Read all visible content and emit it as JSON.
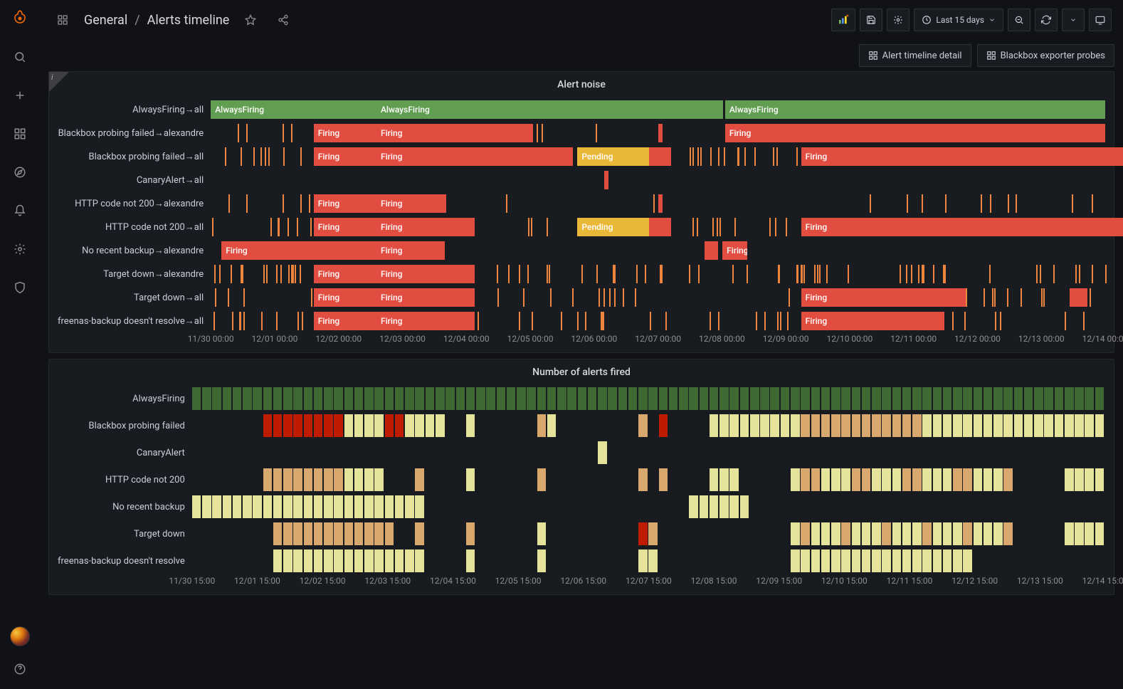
{
  "breadcrumbs": {
    "dashboards_icon": "apps-icon",
    "folder": "General",
    "sep": "/",
    "title": "Alerts timeline"
  },
  "toolbar": {
    "time_label": "Last 15 days",
    "links": [
      {
        "icon": "apps-icon",
        "label": "Alert timeline detail"
      },
      {
        "icon": "apps-icon",
        "label": "Blackbox exporter probes"
      }
    ]
  },
  "panel1": {
    "title": "Alert noise",
    "rows": [
      "AlwaysFiring→all",
      "Blackbox probing failed→alexandre",
      "Blackbox probing failed→all",
      "CanaryAlert→all",
      "HTTP code not 200→alexandre",
      "HTTP code not 200→all",
      "No recent backup→alexandre",
      "Target down→alexandre",
      "Target down→all",
      "freenas-backup doesn't resolve→all"
    ],
    "axis": [
      "11/30 00:00",
      "12/01 00:00",
      "12/02 00:00",
      "12/03 00:00",
      "12/04 00:00",
      "12/05 00:00",
      "12/06 00:00",
      "12/07 00:00",
      "12/08 00:00",
      "12/09 00:00",
      "12/10 00:00",
      "12/11 00:00",
      "12/12 00:00",
      "12/13 00:00",
      "12/14 00:00"
    ],
    "labels": {
      "firing": "Firing",
      "pending": "Pending",
      "always": "AlwaysFiring"
    },
    "chart_data": {
      "type": "timeline",
      "x_range_days": 15,
      "series_states": [
        "Firing",
        "Pending",
        "AlwaysFiring"
      ],
      "segments": {
        "AlwaysFiring→all": [
          {
            "state": "AlwaysFiring",
            "color": "green",
            "start": 0.0,
            "end": 57.3,
            "label": "AlwaysFiring"
          },
          {
            "state": "AlwaysFiring",
            "color": "green",
            "start": 57.5,
            "end": 100.0,
            "label": "AlwaysFiring"
          }
        ],
        "Blackbox probing failed→alexandre": [
          {
            "state": "Firing",
            "color": "red",
            "start": 11.5,
            "end": 36.0,
            "label": "Firing"
          },
          {
            "state": "Firing",
            "color": "red",
            "start": 50.0,
            "end": 50.3
          },
          {
            "state": "Firing",
            "color": "red",
            "start": 57.5,
            "end": 100.0,
            "label": "Firing"
          }
        ],
        "Blackbox probing failed→all": [
          {
            "state": "Pending",
            "color": "orange",
            "start": 0.0,
            "end": 100.0
          },
          {
            "state": "Firing",
            "color": "red",
            "start": 11.5,
            "end": 41.0,
            "label": "Firing"
          },
          {
            "state": "Pending",
            "color": "orange",
            "start": 41.0,
            "end": 49.0,
            "label": "Pending"
          },
          {
            "state": "Firing",
            "color": "red",
            "start": 66.0,
            "end": 100.0,
            "label": "Firing"
          }
        ]
      }
    }
  },
  "panel2": {
    "title": "Number of alerts fired",
    "rows": [
      "AlwaysFiring",
      "Blackbox probing failed",
      "CanaryAlert",
      "HTTP code not 200",
      "No recent backup",
      "Target down",
      "freenas-backup doesn't resolve"
    ],
    "axis": [
      "11/30 15:00",
      "12/01 15:00",
      "12/02 15:00",
      "12/03 15:00",
      "12/04 15:00",
      "12/05 15:00",
      "12/06 15:00",
      "12/07 15:00",
      "12/08 15:00",
      "12/09 15:00",
      "12/10 15:00",
      "12/11 15:00",
      "12/12 15:00",
      "12/13 15:00",
      "12/14 15:00"
    ],
    "chart_data": {
      "type": "heatmap",
      "x_range_days": 15,
      "color_scale": [
        "low→pale-yellow",
        "mid→tan",
        "high→red"
      ],
      "cells_note": "each row is bucketed ~4h intervals; AlwaysFiring is constant green; CanaryAlert has a single cell near 12/06; No recent backup clusters 11/30–12/04 and 12/08; others span 12/01–12/14 with varying intensity"
    }
  }
}
